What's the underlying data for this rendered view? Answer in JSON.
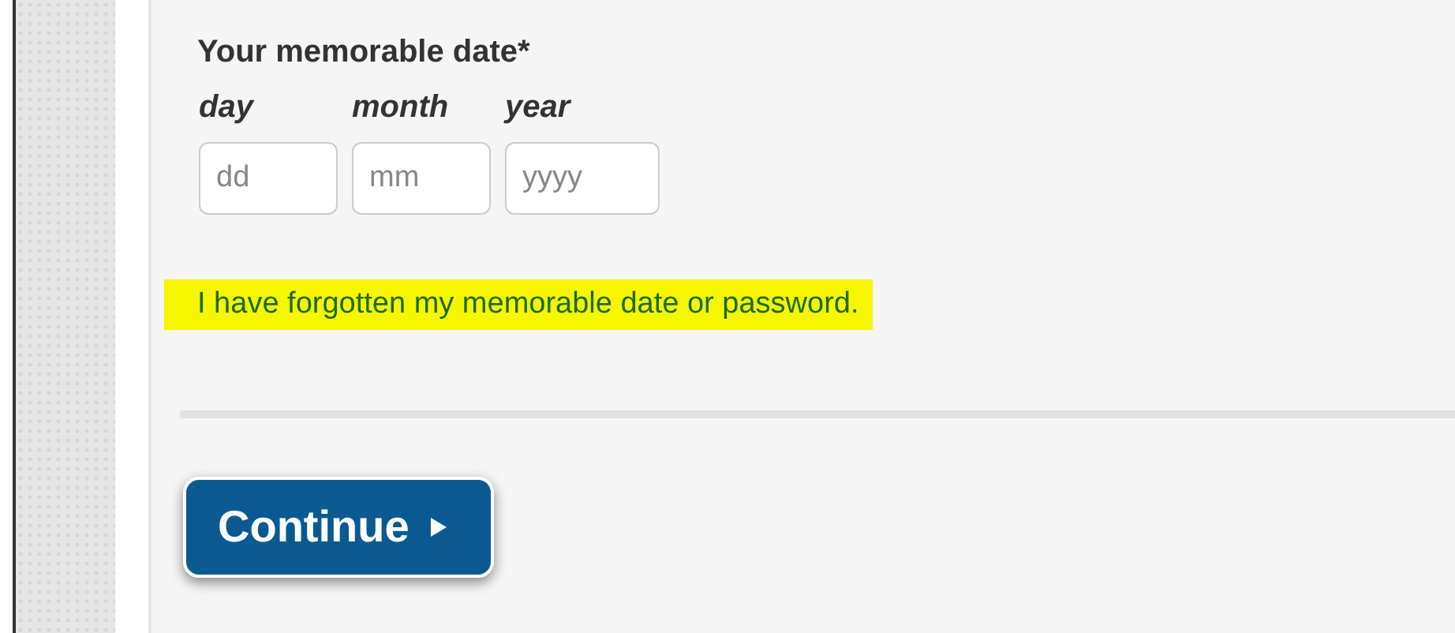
{
  "form": {
    "label": "Your memorable date*",
    "fields": [
      {
        "label": "day",
        "placeholder": "dd"
      },
      {
        "label": "month",
        "placeholder": "mm"
      },
      {
        "label": "year",
        "placeholder": "yyyy"
      }
    ],
    "forgot_link": "I have forgotten my memorable date or password.",
    "continue_button": "Continue"
  }
}
